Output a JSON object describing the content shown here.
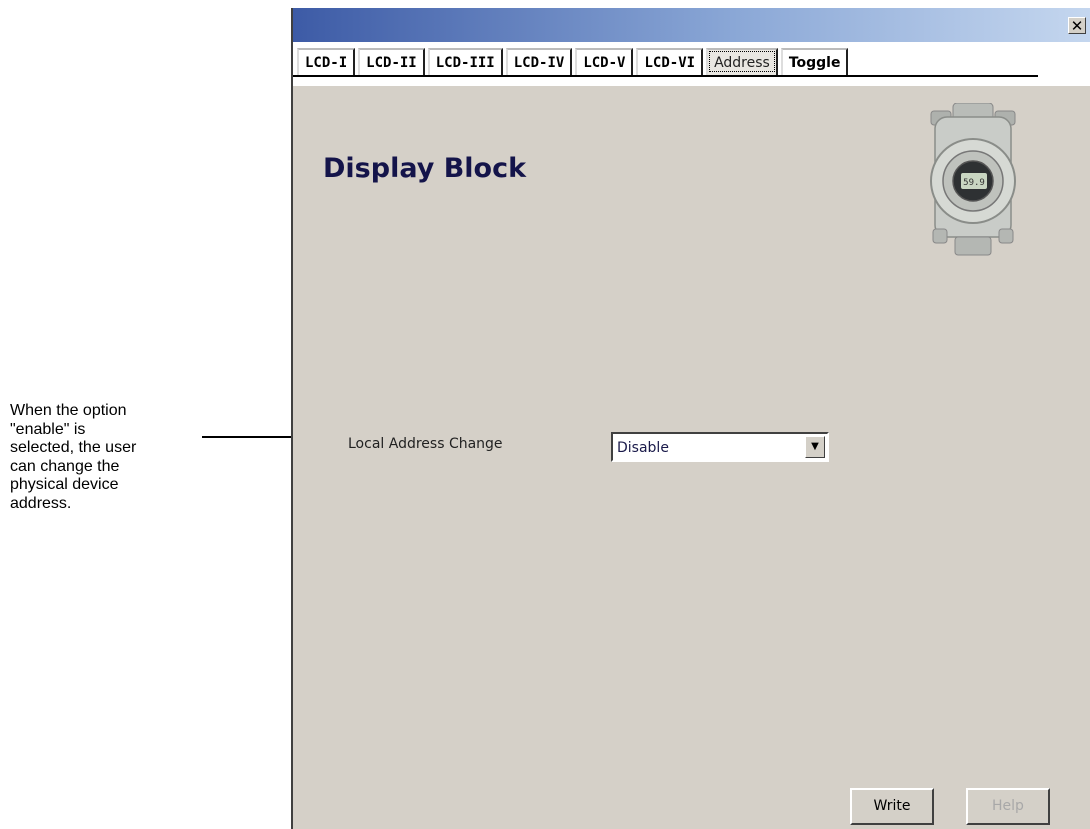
{
  "annotation": {
    "lines": [
      "When the option",
      "\"enable\" is",
      "selected, the user",
      "can change the",
      "physical device",
      "address."
    ]
  },
  "window": {
    "close_label": "✕",
    "tabs": [
      {
        "label": "LCD-I"
      },
      {
        "label": "LCD-II"
      },
      {
        "label": "LCD-III"
      },
      {
        "label": "LCD-IV"
      },
      {
        "label": "LCD-V"
      },
      {
        "label": "LCD-VI"
      },
      {
        "label": "Address"
      },
      {
        "label": "Toggle"
      }
    ],
    "active_tab": "Address",
    "heading": "Display Block",
    "device_display": "59.9",
    "field": {
      "label": "Local Address Change",
      "value": "Disable"
    },
    "buttons": {
      "write": "Write",
      "help": "Help"
    }
  }
}
